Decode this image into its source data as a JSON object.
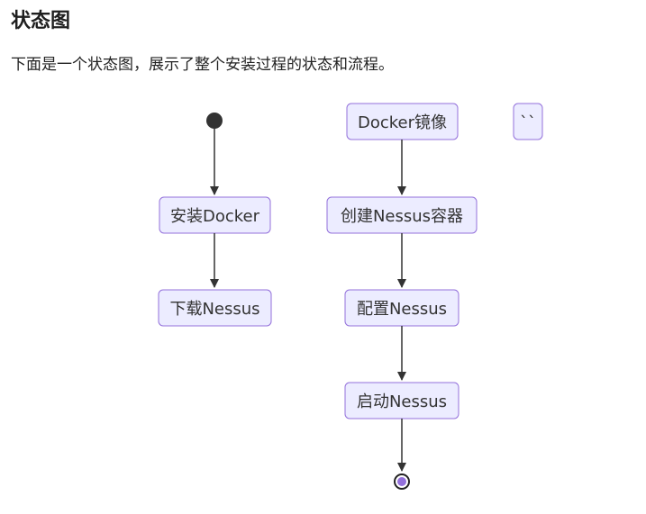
{
  "section": {
    "heading": "状态图",
    "description": "下面是一个状态图，展示了整个安装过程的状态和流程。"
  },
  "diagram": {
    "states": {
      "install_docker": "安装Docker",
      "download_nessus": "下载Nessus",
      "docker_image": "Docker镜像",
      "backtick": "``",
      "create_container": "创建Nessus容器",
      "configure_nessus": "配置Nessus",
      "start_nessus": "启动Nessus"
    },
    "colors": {
      "node_fill": "#ECECFF",
      "node_stroke": "#9370DB",
      "edge": "#333333",
      "start": "#333333",
      "end_inner": "#9370DB"
    }
  }
}
